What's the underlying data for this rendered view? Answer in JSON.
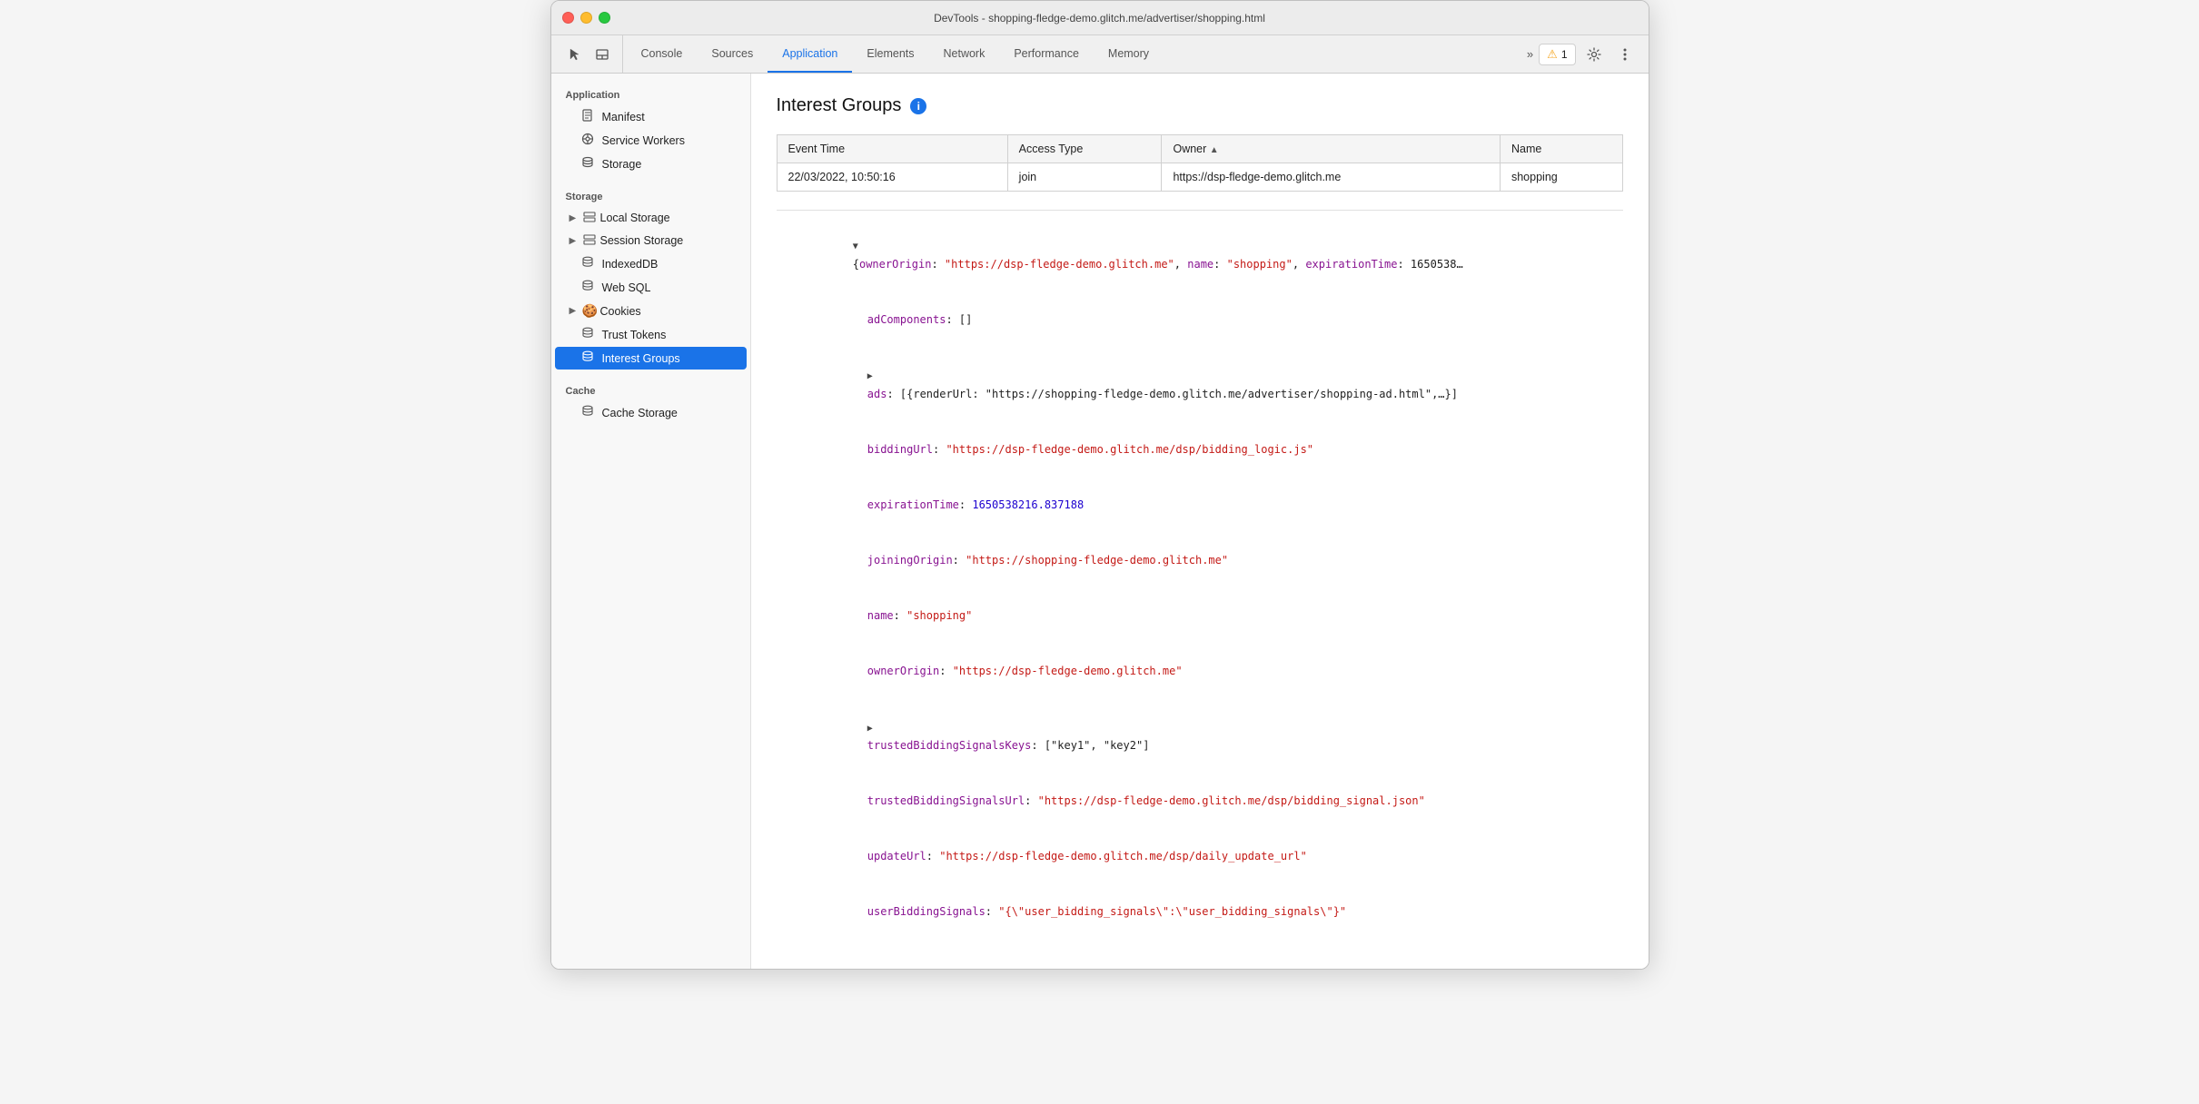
{
  "window": {
    "title": "DevTools - shopping-fledge-demo.glitch.me/advertiser/shopping.html"
  },
  "toolbar": {
    "tabs": [
      {
        "id": "console",
        "label": "Console",
        "active": false
      },
      {
        "id": "sources",
        "label": "Sources",
        "active": false
      },
      {
        "id": "application",
        "label": "Application",
        "active": true
      },
      {
        "id": "elements",
        "label": "Elements",
        "active": false
      },
      {
        "id": "network",
        "label": "Network",
        "active": false
      },
      {
        "id": "performance",
        "label": "Performance",
        "active": false
      },
      {
        "id": "memory",
        "label": "Memory",
        "active": false
      }
    ],
    "warning_count": "1",
    "more_tabs_icon": "»"
  },
  "sidebar": {
    "app_section": "Application",
    "app_items": [
      {
        "id": "manifest",
        "label": "Manifest",
        "icon": "📄"
      },
      {
        "id": "service-workers",
        "label": "Service Workers",
        "icon": "⚙️"
      },
      {
        "id": "storage",
        "label": "Storage",
        "icon": "🗄️"
      }
    ],
    "storage_section": "Storage",
    "storage_items": [
      {
        "id": "local-storage",
        "label": "Local Storage",
        "icon": "▦",
        "hasArrow": true
      },
      {
        "id": "session-storage",
        "label": "Session Storage",
        "icon": "▦",
        "hasArrow": true
      },
      {
        "id": "indexeddb",
        "label": "IndexedDB",
        "icon": "🗄️",
        "hasArrow": false
      },
      {
        "id": "web-sql",
        "label": "Web SQL",
        "icon": "🗄️",
        "hasArrow": false
      },
      {
        "id": "cookies",
        "label": "Cookies",
        "icon": "🍪",
        "hasArrow": true
      },
      {
        "id": "trust-tokens",
        "label": "Trust Tokens",
        "icon": "🗄️",
        "hasArrow": false
      },
      {
        "id": "interest-groups",
        "label": "Interest Groups",
        "icon": "🗄️",
        "hasArrow": false,
        "active": true
      }
    ],
    "cache_section": "Cache",
    "cache_items": [
      {
        "id": "cache-storage",
        "label": "Cache Storage",
        "icon": "🗄️",
        "hasArrow": false
      }
    ]
  },
  "content": {
    "title": "Interest Groups",
    "table": {
      "columns": [
        {
          "id": "event-time",
          "label": "Event Time",
          "sorted": false
        },
        {
          "id": "access-type",
          "label": "Access Type",
          "sorted": false
        },
        {
          "id": "owner",
          "label": "Owner",
          "sorted": true,
          "sort_dir": "▲"
        },
        {
          "id": "name",
          "label": "Name",
          "sorted": false
        }
      ],
      "rows": [
        {
          "event_time": "22/03/2022, 10:50:16",
          "access_type": "join",
          "owner": "https://dsp-fledge-demo.glitch.me",
          "name": "shopping"
        }
      ]
    },
    "json": {
      "root_line": "▼ {ownerOrigin: \"https://dsp-fledge-demo.glitch.me\", name: \"shopping\", expirationTime: 1650538…",
      "lines": [
        {
          "indent": 1,
          "key": "adComponents",
          "sep": ": ",
          "value": "[]",
          "type": "bracket"
        },
        {
          "indent": 1,
          "prefix": "▶ ",
          "key": "ads",
          "sep": ": ",
          "value": "[{renderUrl: \"https://shopping-fledge-demo.glitch.me/advertiser/shopping-ad.html\",…}]",
          "type": "bracket"
        },
        {
          "indent": 1,
          "key": "biddingUrl",
          "sep": ": ",
          "value": "\"https://dsp-fledge-demo.glitch.me/dsp/bidding_logic.js\"",
          "type": "string"
        },
        {
          "indent": 1,
          "key": "expirationTime",
          "sep": ": ",
          "value": "1650538216.837188",
          "type": "number"
        },
        {
          "indent": 1,
          "key": "joiningOrigin",
          "sep": ": ",
          "value": "\"https://shopping-fledge-demo.glitch.me\"",
          "type": "string"
        },
        {
          "indent": 1,
          "key": "name",
          "sep": ": ",
          "value": "\"shopping\"",
          "type": "string"
        },
        {
          "indent": 1,
          "key": "ownerOrigin",
          "sep": ": ",
          "value": "\"https://dsp-fledge-demo.glitch.me\"",
          "type": "string"
        },
        {
          "indent": 1,
          "prefix": "▶ ",
          "key": "trustedBiddingSignalsKeys",
          "sep": ": ",
          "value": "[\"key1\", \"key2\"]",
          "type": "bracket"
        },
        {
          "indent": 1,
          "key": "trustedBiddingSignalsUrl",
          "sep": ": ",
          "value": "\"https://dsp-fledge-demo.glitch.me/dsp/bidding_signal.json\"",
          "type": "string"
        },
        {
          "indent": 1,
          "key": "updateUrl",
          "sep": ": ",
          "value": "\"https://dsp-fledge-demo.glitch.me/dsp/daily_update_url\"",
          "type": "string"
        },
        {
          "indent": 1,
          "key": "userBiddingSignals",
          "sep": ": ",
          "value": "\"{\\\"user_bidding_signals\\\":\\\"user_bidding_signals\\\"}\"",
          "type": "string"
        }
      ]
    }
  }
}
